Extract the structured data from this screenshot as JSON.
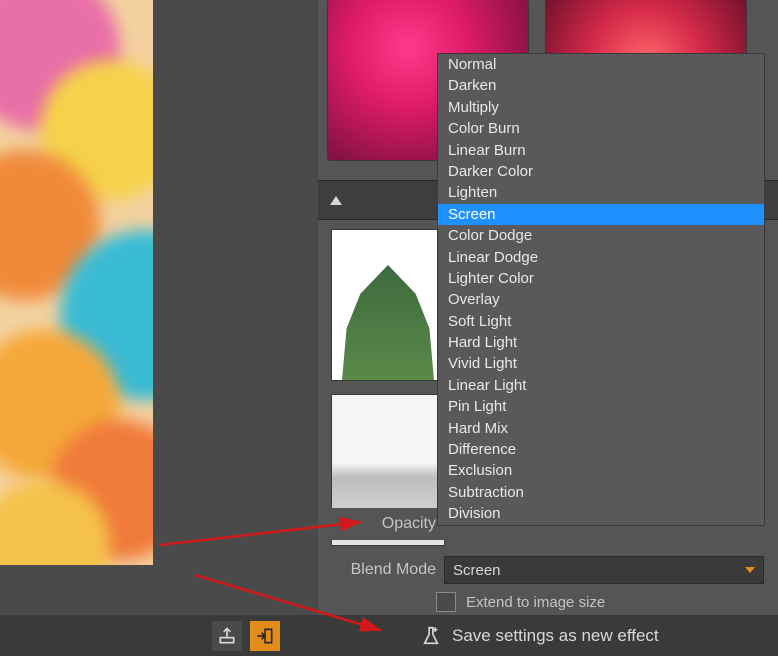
{
  "labels": {
    "opacity": "Opacity",
    "blendMode": "Blend Mode",
    "extend": "Extend to image size",
    "save": "Save settings as new effect"
  },
  "blendModeValue": "Screen",
  "blendModes": [
    "Normal",
    "Darken",
    "Multiply",
    "Color Burn",
    "Linear Burn",
    "Darker Color",
    "Lighten",
    "Screen",
    "Color Dodge",
    "Linear Dodge",
    "Lighter Color",
    "Overlay",
    "Soft Light",
    "Hard Light",
    "Vivid Light",
    "Linear Light",
    "Pin Light",
    "Hard Mix",
    "Difference",
    "Exclusion",
    "Subtraction",
    "Division"
  ],
  "blendModeSelectedIndex": 7,
  "extendChecked": false,
  "icons": {
    "export": "export-icon",
    "apply": "apply-icon",
    "flask": "flask-icon"
  }
}
